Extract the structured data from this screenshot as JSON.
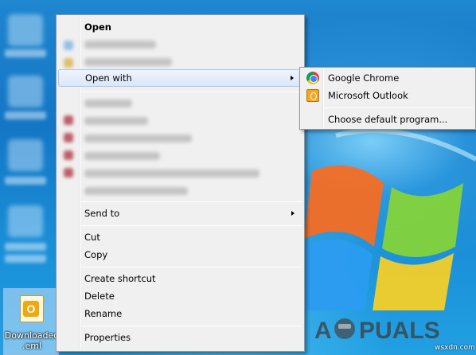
{
  "desktop": {
    "file": {
      "name_line1": "Downloaded",
      "name_line2": ".eml"
    },
    "watermark": "APPUALS",
    "site_mark": "wsxdn.com"
  },
  "context_menu": {
    "open": "Open",
    "open_with": "Open with",
    "send_to": "Send to",
    "cut": "Cut",
    "copy": "Copy",
    "create_shortcut": "Create shortcut",
    "delete": "Delete",
    "rename": "Rename",
    "properties": "Properties"
  },
  "open_with_submenu": {
    "items": [
      "Google Chrome",
      "Microsoft Outlook"
    ],
    "choose_default": "Choose default program..."
  },
  "colors": {
    "highlight_border": "#a8c8ee",
    "menu_background": "#f0f0f0",
    "desktop_blue": "#1a8fd6"
  }
}
